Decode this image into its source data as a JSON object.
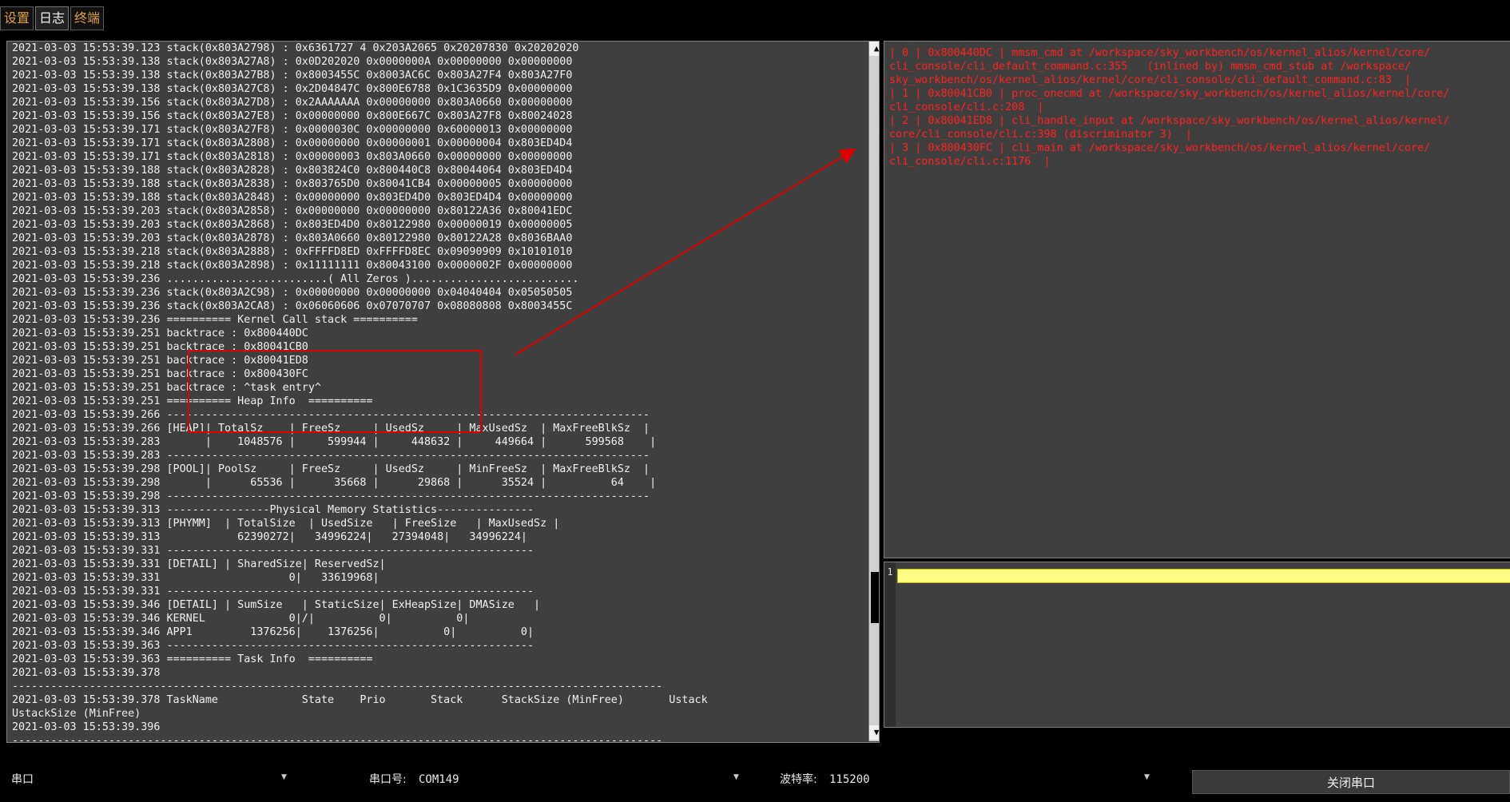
{
  "tabs": [
    "设置",
    "日志",
    "终端"
  ],
  "log_lines": [
    "2021-03-03 15:53:39.123 stack(0x803A2798) : 0x6361727 4 0x203A2065 0x20207830 0x20202020",
    "2021-03-03 15:53:39.138 stack(0x803A27A8) : 0x0D202020 0x0000000A 0x00000000 0x00000000",
    "2021-03-03 15:53:39.138 stack(0x803A27B8) : 0x8003455C 0x8003AC6C 0x803A27F4 0x803A27F0",
    "2021-03-03 15:53:39.138 stack(0x803A27C8) : 0x2D04847C 0x800E6788 0x1C3635D9 0x00000000",
    "2021-03-03 15:53:39.156 stack(0x803A27D8) : 0x2AAAAAAA 0x00000000 0x803A0660 0x00000000",
    "2021-03-03 15:53:39.156 stack(0x803A27E8) : 0x00000000 0x800E667C 0x803A27F8 0x80024028",
    "2021-03-03 15:53:39.171 stack(0x803A27F8) : 0x0000030C 0x00000000 0x60000013 0x00000000",
    "2021-03-03 15:53:39.171 stack(0x803A2808) : 0x00000000 0x00000001 0x00000004 0x803ED4D4",
    "2021-03-03 15:53:39.171 stack(0x803A2818) : 0x00000003 0x803A0660 0x00000000 0x00000000",
    "2021-03-03 15:53:39.188 stack(0x803A2828) : 0x803824C0 0x800440C8 0x80044064 0x803ED4D4",
    "2021-03-03 15:53:39.188 stack(0x803A2838) : 0x803765D0 0x80041CB4 0x00000005 0x00000000",
    "2021-03-03 15:53:39.188 stack(0x803A2848) : 0x00000000 0x803ED4D0 0x803ED4D4 0x00000000",
    "2021-03-03 15:53:39.203 stack(0x803A2858) : 0x00000000 0x00000000 0x80122A36 0x80041EDC",
    "2021-03-03 15:53:39.203 stack(0x803A2868) : 0x803ED4D0 0x80122980 0x00000019 0x00000005",
    "2021-03-03 15:53:39.203 stack(0x803A2878) : 0x803A0660 0x80122980 0x80122A28 0x8036BAA0",
    "2021-03-03 15:53:39.218 stack(0x803A2888) : 0xFFFFD8ED 0xFFFFD8EC 0x09090909 0x10101010",
    "2021-03-03 15:53:39.218 stack(0x803A2898) : 0x11111111 0x80043100 0x0000002F 0x00000000",
    "2021-03-03 15:53:39.236 .........................( All Zeros )..........................",
    "2021-03-03 15:53:39.236 stack(0x803A2C98) : 0x00000000 0x00000000 0x04040404 0x05050505",
    "2021-03-03 15:53:39.236 stack(0x803A2CA8) : 0x06060606 0x07070707 0x08080808 0x8003455C",
    "2021-03-03 15:53:39.236 ========== Kernel Call stack ==========",
    "2021-03-03 15:53:39.251 backtrace : 0x800440DC",
    "2021-03-03 15:53:39.251 backtrace : 0x80041CB0",
    "2021-03-03 15:53:39.251 backtrace : 0x80041ED8",
    "2021-03-03 15:53:39.251 backtrace : 0x800430FC",
    "2021-03-03 15:53:39.251 backtrace : ^task entry^",
    "2021-03-03 15:53:39.251 ========== Heap Info  ==========",
    "2021-03-03 15:53:39.266 ---------------------------------------------------------------------------",
    "2021-03-03 15:53:39.266 [HEAP]| TotalSz    | FreeSz     | UsedSz     | MaxUsedSz  | MaxFreeBlkSz  |",
    "2021-03-03 15:53:39.283       |    1048576 |     599944 |     448632 |     449664 |      599568    |",
    "2021-03-03 15:53:39.283 ---------------------------------------------------------------------------",
    "2021-03-03 15:53:39.298 [POOL]| PoolSz     | FreeSz     | UsedSz     | MinFreeSz  | MaxFreeBlkSz  |",
    "2021-03-03 15:53:39.298       |      65536 |      35668 |      29868 |      35524 |          64    |",
    "2021-03-03 15:53:39.298 ---------------------------------------------------------------------------",
    "2021-03-03 15:53:39.313 ----------------Physical Memory Statistics---------------",
    "2021-03-03 15:53:39.313 [PHYMM]  | TotalSize  | UsedSize   | FreeSize   | MaxUsedSz |",
    "2021-03-03 15:53:39.313            62390272|   34996224|   27394048|   34996224|",
    "2021-03-03 15:53:39.331 ---------------------------------------------------------",
    "2021-03-03 15:53:39.331 [DETAIL] | SharedSize| ReservedSz|",
    "2021-03-03 15:53:39.331                    0|   33619968|",
    "2021-03-03 15:53:39.331 ---------------------------------------------------------",
    "2021-03-03 15:53:39.346 [DETAIL] | SumSize   | StaticSize| ExHeapSize| DMASize   |",
    "2021-03-03 15:53:39.346 KERNEL             0|/|          0|          0|",
    "2021-03-03 15:53:39.346 APP1         1376256|    1376256|          0|          0|",
    "2021-03-03 15:53:39.363 ---------------------------------------------------------",
    "2021-03-03 15:53:39.363 ========== Task Info  ==========",
    "2021-03-03 15:53:39.378",
    "-----------------------------------------------------------------------------------------------------",
    "2021-03-03 15:53:39.378 TaskName             State    Prio       Stack      StackSize (MinFree)       Ustack",
    "UstackSize (MinFree)",
    "2021-03-03 15:53:39.396",
    "-----------------------------------------------------------------------------------------------------"
  ],
  "result_lines": [
    "| 0 | 0x800440DC | mmsm_cmd at /workspace/sky_workbench/os/kernel_alios/kernel/core/",
    "cli_console/cli_default_command.c:355   (inlined by) mmsm_cmd_stub at /workspace/",
    "sky_workbench/os/kernel_alios/kernel/core/cli_console/cli_default_command.c:83  |",
    "| 1 | 0x80041CB0 | proc_onecmd at /workspace/sky_workbench/os/kernel_alios/kernel/core/",
    "cli_console/cli.c:208  |",
    "| 2 | 0x80041ED8 | cli_handle_input at /workspace/sky_workbench/os/kernel_alios/kernel/",
    "core/cli_console/cli.c:398 (discriminator 3)  |",
    "| 3 | 0x800430FC | cli_main at /workspace/sky_workbench/os/kernel_alios/kernel/core/",
    "cli_console/cli.c:1176  |"
  ],
  "editor": {
    "line_number": "1",
    "content": ""
  },
  "bottom_bar": {
    "mode": "串口",
    "port_label": "串口号:",
    "port_value": "COM149",
    "baud_label": "波特率:",
    "baud_value": "115200",
    "close_button": "关闭串口"
  },
  "scroll": {
    "up": "▲",
    "down": "▼"
  },
  "colors": {
    "accent_red": "#e00000",
    "editor_highlight": "#ffff88"
  }
}
